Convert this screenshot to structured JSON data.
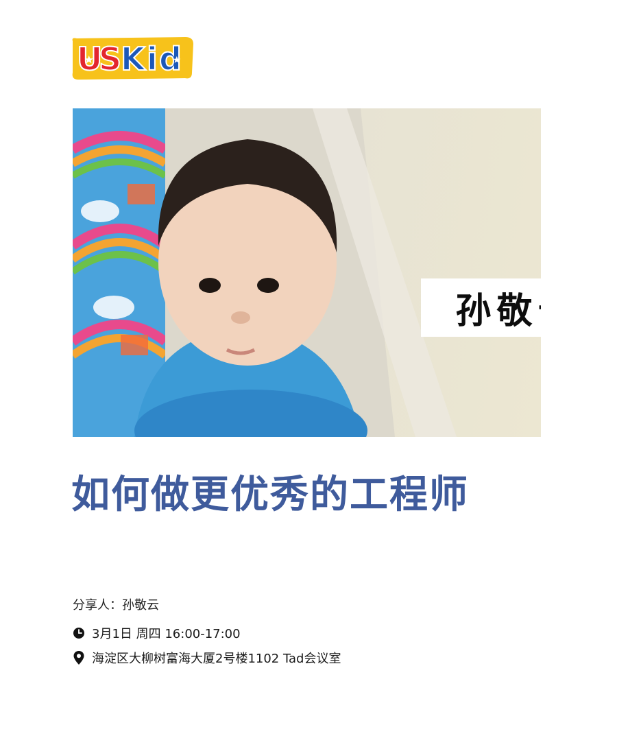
{
  "logo": {
    "text": "USKid",
    "colors": {
      "red": "#e3262e",
      "blue": "#1c58b8",
      "yellow": "#f7c21b"
    }
  },
  "photo": {
    "name_overlay": "孙敬云"
  },
  "event": {
    "title": "如何做更优秀的工程师",
    "speaker_label": "分享人：",
    "speaker_name": "孙敬云",
    "time": "3月1日 周四 16:00-17:00",
    "location": "海淀区大柳树富海大厦2号楼1102 Tad会议室"
  },
  "icons": {
    "time": "clock-icon",
    "location": "map-pin-icon"
  },
  "colors": {
    "title": "#3f5b9c",
    "text": "#1a1a1a"
  }
}
